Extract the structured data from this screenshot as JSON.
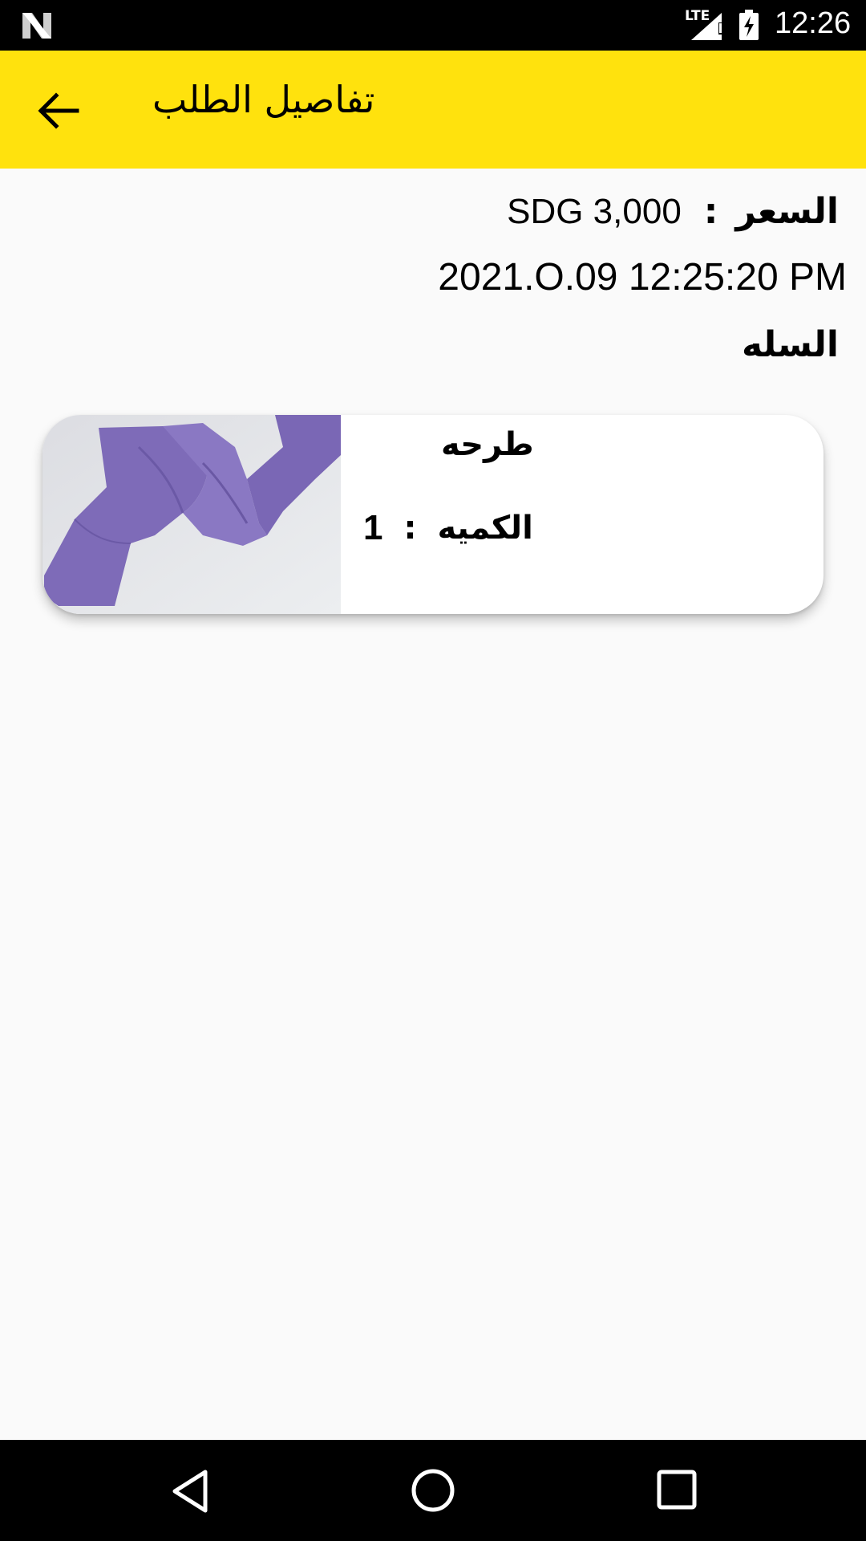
{
  "status_bar": {
    "time": "12:26",
    "network": "LTE",
    "icons": [
      "n-logo-icon",
      "signal-icon",
      "battery-charging-icon"
    ]
  },
  "app_bar": {
    "title": "تفاصيل الطلب",
    "back_icon": "arrow-back-icon",
    "color": "#ffe20d"
  },
  "order": {
    "price_label": "السعر",
    "price_colon": ":",
    "price_value": "SDG 3,000",
    "date": "2021.O.09 12:25:20 PM",
    "cart_title": "السله"
  },
  "cart_items": [
    {
      "name": "طرحه",
      "quantity_label": "الكميه",
      "colon": ":",
      "quantity": "1",
      "image_color": "#7e6bb8"
    }
  ],
  "nav_bar": {
    "icons": [
      "back-triangle-icon",
      "home-circle-icon",
      "recents-square-icon"
    ]
  }
}
